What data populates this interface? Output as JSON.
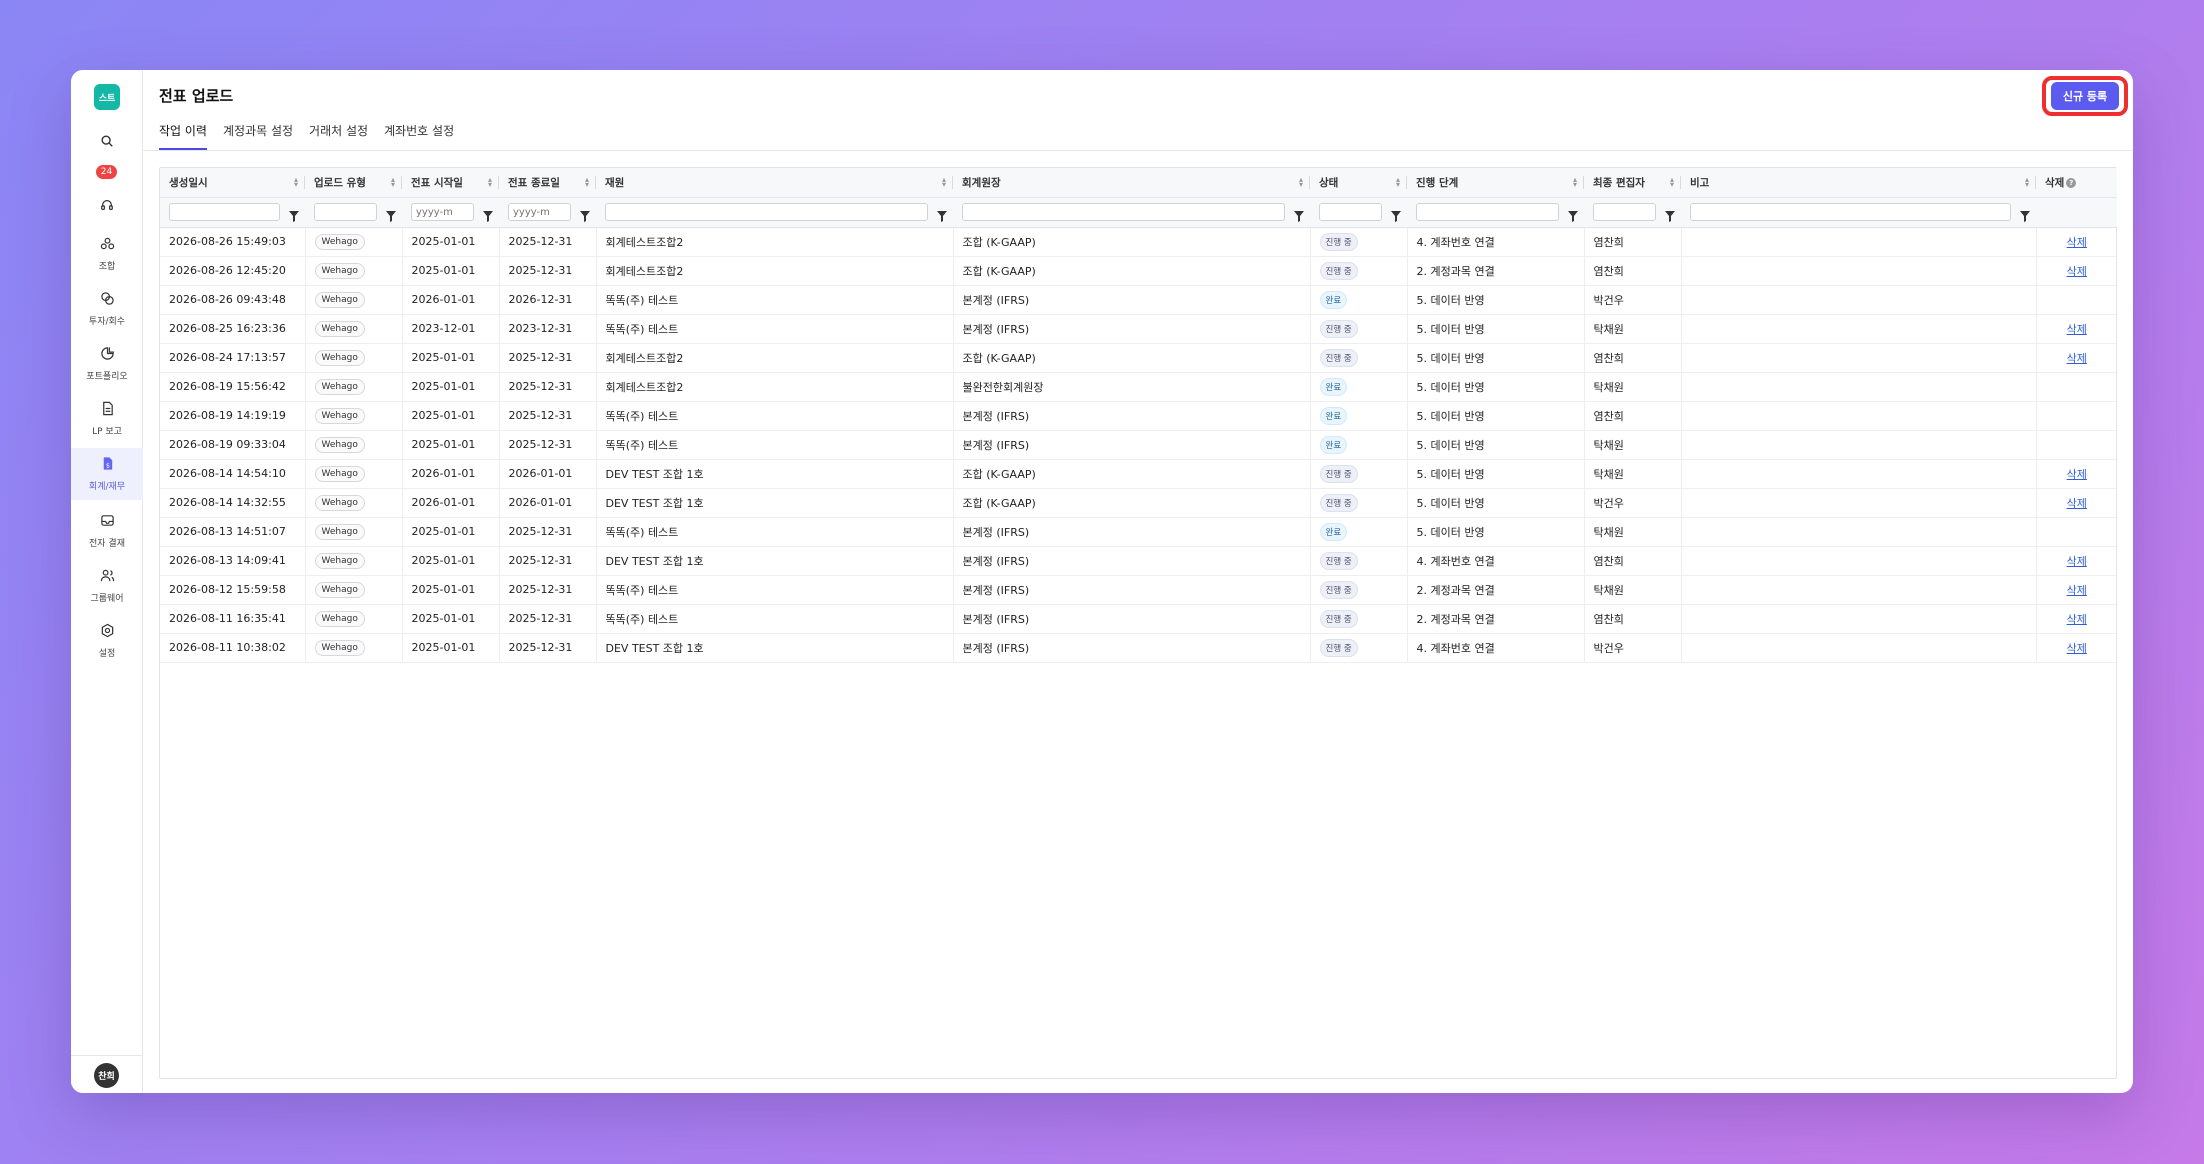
{
  "app": {
    "logo_text": "스트",
    "notification_count": "24",
    "user_initials": "찬희"
  },
  "sidebar": {
    "items": [
      {
        "label": "조합",
        "icon": "cluster-icon"
      },
      {
        "label": "투자/회수",
        "icon": "exchange-icon"
      },
      {
        "label": "포트폴리오",
        "icon": "pie-chart-icon"
      },
      {
        "label": "LP 보고",
        "icon": "document-icon"
      },
      {
        "label": "회계/재무",
        "icon": "ledger-icon"
      },
      {
        "label": "전자 결재",
        "icon": "inbox-icon"
      },
      {
        "label": "그룹웨어",
        "icon": "users-icon"
      },
      {
        "label": "설정",
        "icon": "gear-icon"
      }
    ],
    "active_index": 4
  },
  "header": {
    "title": "전표 업로드",
    "tabs": [
      "작업 이력",
      "계정과목 설정",
      "거래처 설정",
      "계좌번호 설정"
    ],
    "active_tab": 0,
    "new_button_label": "신규 등록"
  },
  "grid": {
    "columns": [
      "생성일시",
      "업로드 유형",
      "전표 시작일",
      "전표 종료일",
      "재원",
      "회계원장",
      "상태",
      "진행 단계",
      "최종 편집자",
      "비고",
      "삭제"
    ],
    "date_placeholder": "yyyy-m",
    "delete_label": "삭제",
    "rows": [
      {
        "created": "2026-08-26 15:49:03",
        "type": "Wehago",
        "start": "2025-01-01",
        "end": "2025-12-31",
        "fund": "회계테스트조합2",
        "ledger": "조합 (K-GAAP)",
        "status": "진행 중",
        "status_kind": "prog",
        "step": "4. 계좌번호 연결",
        "editor": "염찬희",
        "note": "",
        "deletable": true
      },
      {
        "created": "2026-08-26 12:45:20",
        "type": "Wehago",
        "start": "2025-01-01",
        "end": "2025-12-31",
        "fund": "회계테스트조합2",
        "ledger": "조합 (K-GAAP)",
        "status": "진행 중",
        "status_kind": "prog",
        "step": "2. 계정과목 연결",
        "editor": "염찬희",
        "note": "",
        "deletable": true
      },
      {
        "created": "2026-08-26 09:43:48",
        "type": "Wehago",
        "start": "2026-01-01",
        "end": "2026-12-31",
        "fund": "똑똑(주) 테스트",
        "ledger": "본계정 (IFRS)",
        "status": "완료",
        "status_kind": "done",
        "step": "5. 데이터 반영",
        "editor": "박건우",
        "note": "",
        "deletable": false
      },
      {
        "created": "2026-08-25 16:23:36",
        "type": "Wehago",
        "start": "2023-12-01",
        "end": "2023-12-31",
        "fund": "똑똑(주) 테스트",
        "ledger": "본계정 (IFRS)",
        "status": "진행 중",
        "status_kind": "prog",
        "step": "5. 데이터 반영",
        "editor": "탁채원",
        "note": "",
        "deletable": true
      },
      {
        "created": "2026-08-24 17:13:57",
        "type": "Wehago",
        "start": "2025-01-01",
        "end": "2025-12-31",
        "fund": "회계테스트조합2",
        "ledger": "조합 (K-GAAP)",
        "status": "진행 중",
        "status_kind": "prog",
        "step": "5. 데이터 반영",
        "editor": "염찬희",
        "note": "",
        "deletable": true
      },
      {
        "created": "2026-08-19 15:56:42",
        "type": "Wehago",
        "start": "2025-01-01",
        "end": "2025-12-31",
        "fund": "회계테스트조합2",
        "ledger": "불완전한회계원장",
        "status": "완료",
        "status_kind": "done",
        "step": "5. 데이터 반영",
        "editor": "탁채원",
        "note": "",
        "deletable": false
      },
      {
        "created": "2026-08-19 14:19:19",
        "type": "Wehago",
        "start": "2025-01-01",
        "end": "2025-12-31",
        "fund": "똑똑(주) 테스트",
        "ledger": "본계정 (IFRS)",
        "status": "완료",
        "status_kind": "done",
        "step": "5. 데이터 반영",
        "editor": "염찬희",
        "note": "",
        "deletable": false
      },
      {
        "created": "2026-08-19 09:33:04",
        "type": "Wehago",
        "start": "2025-01-01",
        "end": "2025-12-31",
        "fund": "똑똑(주) 테스트",
        "ledger": "본계정 (IFRS)",
        "status": "완료",
        "status_kind": "done",
        "step": "5. 데이터 반영",
        "editor": "탁채원",
        "note": "",
        "deletable": false
      },
      {
        "created": "2026-08-14 14:54:10",
        "type": "Wehago",
        "start": "2026-01-01",
        "end": "2026-01-01",
        "fund": "DEV TEST 조합 1호",
        "ledger": "조합 (K-GAAP)",
        "status": "진행 중",
        "status_kind": "prog",
        "step": "5. 데이터 반영",
        "editor": "탁채원",
        "note": "",
        "deletable": true
      },
      {
        "created": "2026-08-14 14:32:55",
        "type": "Wehago",
        "start": "2026-01-01",
        "end": "2026-01-01",
        "fund": "DEV TEST 조합 1호",
        "ledger": "조합 (K-GAAP)",
        "status": "진행 중",
        "status_kind": "prog",
        "step": "5. 데이터 반영",
        "editor": "박건우",
        "note": "",
        "deletable": true
      },
      {
        "created": "2026-08-13 14:51:07",
        "type": "Wehago",
        "start": "2025-01-01",
        "end": "2025-12-31",
        "fund": "똑똑(주) 테스트",
        "ledger": "본계정 (IFRS)",
        "status": "완료",
        "status_kind": "done",
        "step": "5. 데이터 반영",
        "editor": "탁채원",
        "note": "",
        "deletable": false
      },
      {
        "created": "2026-08-13 14:09:41",
        "type": "Wehago",
        "start": "2025-01-01",
        "end": "2025-12-31",
        "fund": "DEV TEST 조합 1호",
        "ledger": "본계정 (IFRS)",
        "status": "진행 중",
        "status_kind": "prog",
        "step": "4. 계좌번호 연결",
        "editor": "염찬희",
        "note": "",
        "deletable": true
      },
      {
        "created": "2026-08-12 15:59:58",
        "type": "Wehago",
        "start": "2025-01-01",
        "end": "2025-12-31",
        "fund": "똑똑(주) 테스트",
        "ledger": "본계정 (IFRS)",
        "status": "진행 중",
        "status_kind": "prog",
        "step": "2. 계정과목 연결",
        "editor": "탁채원",
        "note": "",
        "deletable": true
      },
      {
        "created": "2026-08-11 16:35:41",
        "type": "Wehago",
        "start": "2025-01-01",
        "end": "2025-12-31",
        "fund": "똑똑(주) 테스트",
        "ledger": "본계정 (IFRS)",
        "status": "진행 중",
        "status_kind": "prog",
        "step": "2. 계정과목 연결",
        "editor": "염찬희",
        "note": "",
        "deletable": true
      },
      {
        "created": "2026-08-11 10:38:02",
        "type": "Wehago",
        "start": "2025-01-01",
        "end": "2025-12-31",
        "fund": "DEV TEST 조합 1호",
        "ledger": "본계정 (IFRS)",
        "status": "진행 중",
        "status_kind": "prog",
        "step": "4. 계좌번호 연결",
        "editor": "박건우",
        "note": "",
        "deletable": true
      }
    ]
  },
  "colors": {
    "accent": "#5b5bf0",
    "highlight_ring": "#ef2f2f",
    "logo_bg": "#14b8a6",
    "badge_bg": "#ef4444"
  }
}
